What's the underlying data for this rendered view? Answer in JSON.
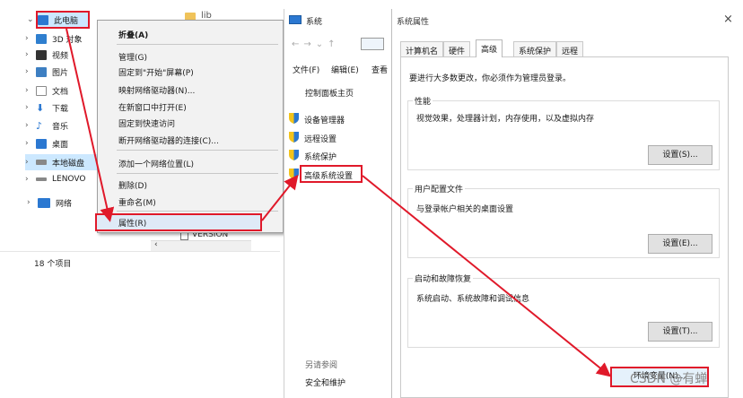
{
  "explorer": {
    "folder_partial": "lib",
    "version_partial": "VERSION",
    "status": "18 个项目",
    "tree": [
      {
        "label": "此电脑",
        "icon": "monitor-icon",
        "color": "#2b78d1"
      },
      {
        "label": "3D 对象",
        "icon": "cube-3d-icon",
        "color": "#2f7fcf"
      },
      {
        "label": "视频",
        "icon": "film-icon",
        "color": "#333333"
      },
      {
        "label": "图片",
        "icon": "picture-icon",
        "color": "#3d7fc2"
      },
      {
        "label": "文档",
        "icon": "document-icon",
        "color": "#8a8a8a"
      },
      {
        "label": "下载",
        "icon": "download-arrow-icon",
        "color": "#2b78d1"
      },
      {
        "label": "音乐",
        "icon": "music-note-icon",
        "color": "#2b78d1"
      },
      {
        "label": "桌面",
        "icon": "desktop-icon",
        "color": "#2b78d1"
      },
      {
        "label": "本地磁盘",
        "icon": "hard-drive-icon",
        "color": "#666666"
      },
      {
        "label": "LENOVO",
        "icon": "drive-icon",
        "color": "#666666"
      },
      {
        "label": "网络",
        "icon": "network-icon",
        "color": "#2b78d1"
      }
    ]
  },
  "context_menu": {
    "items": [
      "折叠(A)",
      "管理(G)",
      "固定到\"开始\"屏幕(P)",
      "映射网络驱动器(N)...",
      "在新窗口中打开(E)",
      "固定到快速访问",
      "断开网络驱动器的连接(C)...",
      "添加一个网络位置(L)",
      "删除(D)",
      "重命名(M)",
      "属性(R)"
    ]
  },
  "system_window": {
    "title": "系统",
    "toolbar": {
      "menu_file": "文件(F)",
      "menu_edit": "编辑(E)",
      "menu_view": "查看"
    },
    "control_panel_home": "控制面板主页",
    "links": [
      "设备管理器",
      "远程设置",
      "系统保护",
      "高级系统设置"
    ],
    "see_also": "另请参阅",
    "security": "安全和维护"
  },
  "dialog": {
    "title": "系统属性",
    "close": "×",
    "tabs": [
      "计算机名",
      "硬件",
      "高级",
      "系统保护",
      "远程"
    ],
    "admin_note": "要进行大多数更改，你必须作为管理员登录。",
    "groups": [
      {
        "title": "性能",
        "desc": "视觉效果，处理器计划，内存使用，以及虚拟内存",
        "button": "设置(S)..."
      },
      {
        "title": "用户配置文件",
        "desc": "与登录帐户相关的桌面设置",
        "button": "设置(E)..."
      },
      {
        "title": "启动和故障恢复",
        "desc": "系统启动、系统故障和调试信息",
        "button": "设置(T)..."
      }
    ],
    "env_button": "环境变量(N)..."
  },
  "watermark": "CSDN @有蝉",
  "colors": {
    "highlight_red": "#e0192a",
    "selection_blue": "#cce8ff",
    "link_blue": "#2b78d1"
  }
}
